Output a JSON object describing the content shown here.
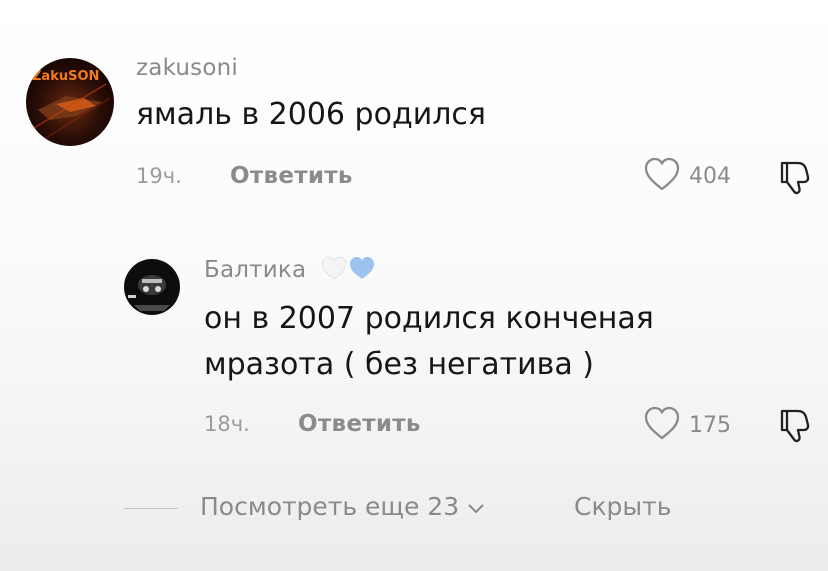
{
  "comments": [
    {
      "username": "zakusoni",
      "avatar_text": "ZakuSON",
      "text_lines": [
        "ямаль в 2006 родился"
      ],
      "time": "19ч.",
      "reply_label": "Ответить",
      "likes": "404",
      "icons": [
        "heart-outline-icon",
        "thumbs-down-icon"
      ]
    },
    {
      "username": "Балтика",
      "text_lines": [
        "он в 2007 родился конченая",
        "мразота ( без негатива )"
      ],
      "time": "18ч.",
      "reply_label": "Ответить",
      "likes": "175",
      "icons": [
        "white-heart-icon",
        "blue-heart-icon",
        "heart-outline-icon",
        "thumbs-down-icon"
      ]
    }
  ],
  "footer": {
    "view_more_label": "Посмотреть еще 23",
    "hide_label": "Скрыть"
  },
  "colors": {
    "text": "#161616",
    "secondary": "#8a8a8a",
    "blue_heart": "#9cc3f0",
    "avatar1_bg": "#2a0d06",
    "avatar1_accent": "#e8641a"
  }
}
